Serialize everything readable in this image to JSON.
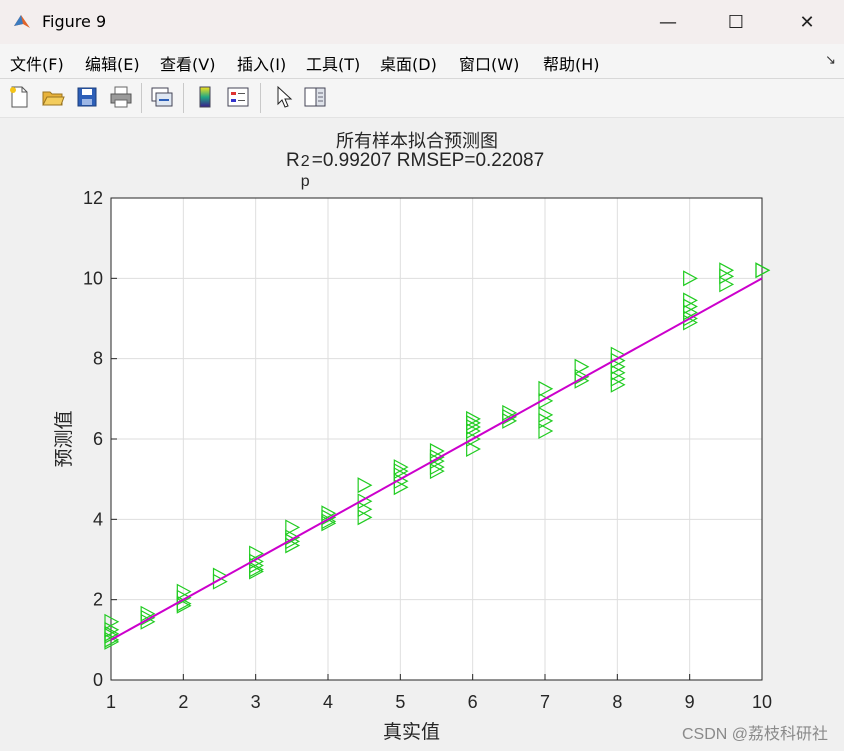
{
  "window": {
    "title": "Figure 9",
    "buttons": {
      "minimize": "—",
      "maximize": "☐",
      "close": "✕"
    }
  },
  "menu": {
    "items": [
      "文件(F)",
      "编辑(E)",
      "查看(V)",
      "插入(I)",
      "工具(T)",
      "桌面(D)",
      "窗口(W)",
      "帮助(H)"
    ],
    "corner": "↘"
  },
  "toolbar": {
    "icons": [
      "new-figure-icon",
      "open-file-icon",
      "save-icon",
      "print-icon",
      "link-plot-icon",
      "colorbar-icon",
      "legend-icon",
      "edit-plot-arrow-icon",
      "property-inspector-icon"
    ]
  },
  "chart_data": {
    "type": "scatter",
    "title": "所有样本拟合预测图",
    "subtitle_parts": {
      "r": "R",
      "sup": "2",
      "sub": "p",
      "rest": "=0.99207  RMSEP=0.22087"
    },
    "xlabel": "真实值",
    "ylabel": "预测值",
    "xlim": [
      1,
      10
    ],
    "ylim": [
      0,
      12
    ],
    "xticks": [
      1,
      2,
      3,
      4,
      5,
      6,
      7,
      8,
      9,
      10
    ],
    "yticks": [
      0,
      2,
      4,
      6,
      8,
      10,
      12
    ],
    "grid": true,
    "marker": "triangle-right",
    "marker_color": "#22cc22",
    "line_color": "#cc00cc",
    "fit_line": {
      "x": [
        1,
        10
      ],
      "y": [
        1,
        10
      ]
    },
    "points": [
      [
        1,
        1.45
      ],
      [
        1,
        1.25
      ],
      [
        1,
        1.15
      ],
      [
        1,
        1.1
      ],
      [
        1,
        1.0
      ],
      [
        1,
        0.95
      ],
      [
        1.5,
        1.65
      ],
      [
        1.5,
        1.55
      ],
      [
        1.5,
        1.45
      ],
      [
        2,
        2.2
      ],
      [
        2,
        2.05
      ],
      [
        2,
        1.9
      ],
      [
        2,
        1.85
      ],
      [
        2.5,
        2.6
      ],
      [
        2.5,
        2.45
      ],
      [
        3,
        3.15
      ],
      [
        3,
        2.95
      ],
      [
        3,
        2.85
      ],
      [
        3,
        2.75
      ],
      [
        3,
        2.7
      ],
      [
        3.5,
        3.8
      ],
      [
        3.5,
        3.55
      ],
      [
        3.5,
        3.45
      ],
      [
        3.5,
        3.35
      ],
      [
        4,
        4.15
      ],
      [
        4,
        4.05
      ],
      [
        4,
        3.95
      ],
      [
        4,
        3.9
      ],
      [
        4.5,
        4.85
      ],
      [
        4.5,
        4.45
      ],
      [
        4.5,
        4.25
      ],
      [
        4.5,
        4.05
      ],
      [
        5,
        5.3
      ],
      [
        5,
        5.2
      ],
      [
        5,
        5.1
      ],
      [
        5,
        4.95
      ],
      [
        5,
        4.8
      ],
      [
        5.5,
        5.7
      ],
      [
        5.5,
        5.55
      ],
      [
        5.5,
        5.45
      ],
      [
        5.5,
        5.3
      ],
      [
        5.5,
        5.2
      ],
      [
        6,
        6.5
      ],
      [
        6,
        6.4
      ],
      [
        6,
        6.3
      ],
      [
        6,
        6.2
      ],
      [
        6,
        6.0
      ],
      [
        6,
        5.75
      ],
      [
        6.5,
        6.65
      ],
      [
        6.5,
        6.55
      ],
      [
        6.5,
        6.45
      ],
      [
        7,
        7.25
      ],
      [
        7,
        6.95
      ],
      [
        7,
        6.6
      ],
      [
        7,
        6.45
      ],
      [
        7,
        6.2
      ],
      [
        7.5,
        7.8
      ],
      [
        7.5,
        7.55
      ],
      [
        7.5,
        7.45
      ],
      [
        8,
        8.1
      ],
      [
        8,
        7.95
      ],
      [
        8,
        7.8
      ],
      [
        8,
        7.65
      ],
      [
        8,
        7.5
      ],
      [
        8,
        7.35
      ],
      [
        9,
        10.0
      ],
      [
        9,
        9.45
      ],
      [
        9,
        9.3
      ],
      [
        9,
        9.15
      ],
      [
        9,
        9.0
      ],
      [
        9,
        8.9
      ],
      [
        9.5,
        10.2
      ],
      [
        9.5,
        10.05
      ],
      [
        9.5,
        9.85
      ],
      [
        10,
        10.2
      ],
      [
        10,
        10.2
      ]
    ]
  },
  "watermark": "CSDN @荔枝科研社"
}
